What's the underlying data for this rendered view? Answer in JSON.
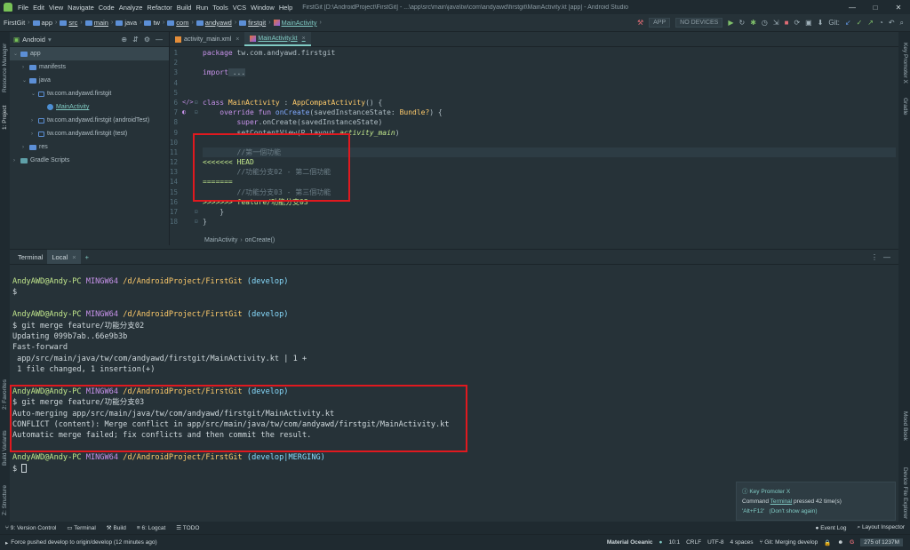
{
  "window": {
    "title": "FirstGit [D:\\AndroidProject\\FirstGit] - ...\\app\\src\\main\\java\\tw\\com\\andyawd\\firstgit\\MainActivity.kt [app] - Android Studio",
    "menu": [
      "File",
      "Edit",
      "View",
      "Navigate",
      "Code",
      "Analyze",
      "Refactor",
      "Build",
      "Run",
      "Tools",
      "VCS",
      "Window",
      "Help"
    ],
    "minimize": "—",
    "maximize": "□",
    "close": "✕"
  },
  "navbar": {
    "crumbs": [
      "FirstGit",
      "app",
      "src",
      "main",
      "java",
      "tw",
      "com",
      "andyawd",
      "firstgit",
      "MainActivity"
    ],
    "run_config": "APP",
    "device": "NO DEVICES",
    "git_label": "Git:"
  },
  "project": {
    "view_mode": "Android",
    "tree": [
      {
        "label": "app",
        "depth": 0,
        "chev": "v",
        "icon": "folder",
        "selected": true
      },
      {
        "label": "manifests",
        "depth": 1,
        "chev": ">",
        "icon": "folder"
      },
      {
        "label": "java",
        "depth": 1,
        "chev": "v",
        "icon": "folder"
      },
      {
        "label": "tw.com.andyawd.firstgit",
        "depth": 2,
        "chev": "v",
        "icon": "pkg"
      },
      {
        "label": "MainActivity",
        "depth": 3,
        "chev": "",
        "icon": "class",
        "highlight": true
      },
      {
        "label": "tw.com.andyawd.firstgit (androidTest)",
        "depth": 2,
        "chev": ">",
        "icon": "pkg"
      },
      {
        "label": "tw.com.andyawd.firstgit (test)",
        "depth": 2,
        "chev": ">",
        "icon": "pkg"
      },
      {
        "label": "res",
        "depth": 1,
        "chev": ">",
        "icon": "folder"
      },
      {
        "label": "Gradle Scripts",
        "depth": 0,
        "chev": ">",
        "icon": "gradle"
      }
    ]
  },
  "editor": {
    "tabs": [
      {
        "label": "activity_main.xml",
        "active": false
      },
      {
        "label": "MainActivity.kt",
        "active": true
      }
    ],
    "lines": [
      "1",
      "2",
      "3",
      "4",
      "5",
      "6",
      "7",
      "8",
      "9",
      "10",
      "11",
      "12",
      "13",
      "14",
      "15",
      "16",
      "17",
      "18"
    ],
    "code": {
      "l1_kw": "package",
      "l1_rest": " tw.com.andyawd.firstgit",
      "l3_kw": "import",
      "l3_rest": " ...",
      "l6_kw": "class",
      "l6_name": " MainActivity",
      "l6_rest": " : ",
      "l6_type": "AppCompatActivity",
      "l6_end": "() {",
      "l7_kw": "override fun",
      "l7_fn": " onCreate",
      "l7_rest": "(savedInstanceState: ",
      "l7_type": "Bundle?",
      "l7_end": ") {",
      "l8_kw": "super",
      "l8_rest": ".onCreate(savedInstanceState)",
      "l9_pre": "setContentView(R.layout.",
      "l9_it": "activity_main",
      "l9_end": ")",
      "l11": "//第一個功能",
      "l12": "<<<<<<< HEAD",
      "l13": "//功能分支02 - 第二個功能",
      "l14": "=======",
      "l15": "//功能分支03 - 第三個功能",
      "l16": ">>>>>>> feature/功能分支03",
      "l17": "}",
      "l18": "}"
    },
    "breadcrumb": [
      "MainActivity",
      "onCreate()"
    ]
  },
  "terminal": {
    "header": "Terminal",
    "tab": "Local",
    "lines": {
      "a_user": "AndyAWD@Andy-PC",
      "a_host": " MINGW64",
      "a_path": " /d/AndroidProject/FirstGit",
      "a_branch": " (develop)",
      "a_prompt": "$",
      "b_cmd": "$ git merge feature/功能分支02",
      "b_1": "Updating 099b7ab..66e9b3b",
      "b_2": "Fast-forward",
      "b_3": " app/src/main/java/tw/com/andyawd/firstgit/MainActivity.kt | 1 +",
      "b_4": " 1 file changed, 1 insertion(+)",
      "c_cmd": "$ git merge feature/功能分支03",
      "c_1": "Auto-merging app/src/main/java/tw/com/andyawd/firstgit/MainActivity.kt",
      "c_2": "CONFLICT (content): Merge conflict in app/src/main/java/tw/com/andyawd/firstgit/MainActivity.kt",
      "c_3": "Automatic merge failed; fix conflicts and then commit the result.",
      "d_branch": " (develop|MERGING)"
    }
  },
  "notification": {
    "title": "Key Promoter X",
    "body_pre": "Command ",
    "body_link": "Terminal",
    "body_post": " pressed 42 time(s)",
    "shortcut": "'Alt+F12'",
    "dismiss": "(Don't show again)"
  },
  "bottom_tools": [
    "9: Version Control",
    "Terminal",
    "Build",
    "6: Logcat",
    "TODO"
  ],
  "bottom_right": [
    "Event Log",
    "Layout Inspector"
  ],
  "status": {
    "message": "Force pushed develop to origin/develop (12 minutes ago)",
    "theme": "Material Oceanic",
    "position": "10:1",
    "line_sep": "CRLF",
    "encoding": "UTF-8",
    "indent": "4 spaces",
    "git": "Git: Merging develop",
    "memory": "275 of 1237M"
  },
  "side_tabs": {
    "left": [
      "Resource Manager",
      "1: Project",
      "2: Favorites",
      "Build Variants",
      "Z: Structure"
    ],
    "right": [
      "Key Promoter X",
      "Gradle",
      "Mood Book",
      "Device File Explorer"
    ]
  }
}
